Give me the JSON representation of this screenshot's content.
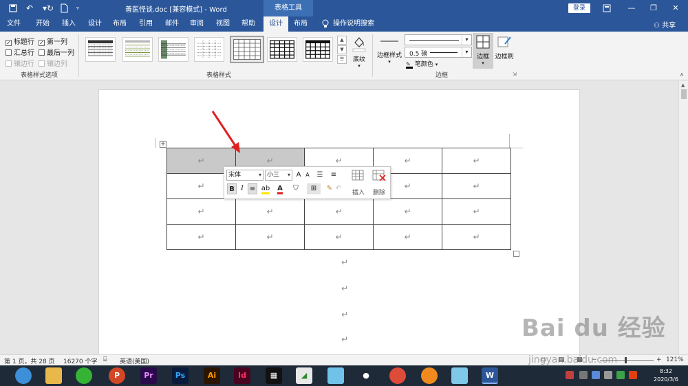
{
  "titlebar": {
    "doc_title": "善医怪谈.doc [兼容模式] - Word",
    "context_title": "表格工具",
    "login": "登录",
    "colors": {
      "bar": "#2b579a"
    }
  },
  "tabs": [
    {
      "label": "文件"
    },
    {
      "label": "开始"
    },
    {
      "label": "插入"
    },
    {
      "label": "设计"
    },
    {
      "label": "布局"
    },
    {
      "label": "引用"
    },
    {
      "label": "邮件"
    },
    {
      "label": "审阅"
    },
    {
      "label": "视图"
    },
    {
      "label": "帮助"
    },
    {
      "label": "设计",
      "active": true
    },
    {
      "label": "布局"
    }
  ],
  "search": {
    "label": "操作说明搜索"
  },
  "share": "共享",
  "ribbon": {
    "options": [
      {
        "label": "标题行",
        "checked": true
      },
      {
        "label": "第一列",
        "checked": true
      },
      {
        "label": "汇总行",
        "checked": false
      },
      {
        "label": "最后一列",
        "checked": false
      },
      {
        "label": "镶边行",
        "checked": false,
        "disabled": true
      },
      {
        "label": "镶边列",
        "checked": false,
        "disabled": true
      }
    ],
    "options_group": "表格样式选项",
    "styles_group": "表格样式",
    "shading": "底纹",
    "border_styles": "边框样式",
    "line_weight": "0.5 磅",
    "pen_color": "笔颜色",
    "borders": "边框",
    "border_painter": "边框刷",
    "borders_group": "边框"
  },
  "table": {
    "rows": [
      [
        "↵",
        "↵",
        "↵",
        "↵",
        "↵"
      ],
      [
        "↵",
        "↵",
        "↵",
        "↵",
        "↵"
      ],
      [
        "↵",
        "↵",
        "↵",
        "↵",
        "↵"
      ],
      [
        "↵",
        "↵",
        "↵",
        "↵",
        "↵"
      ]
    ],
    "selected_cells": [
      [
        0,
        0
      ],
      [
        0,
        1
      ]
    ],
    "paragraph_marks": [
      "↵",
      "↵",
      "↵",
      "↵"
    ],
    "move_handle": "+"
  },
  "minitoolbar": {
    "font": "宋体",
    "size": "小三",
    "grow": "A",
    "shrink": "A",
    "bold": "B",
    "italic": "I",
    "font_color": "A",
    "insert": "插入",
    "delete": "删除"
  },
  "statusbar": {
    "page": "第 1 页，共 28 页",
    "words": "16270 个字",
    "language": "英语(美国)",
    "zoom": "121%"
  },
  "taskbar": {
    "apps": [
      "Pr",
      "Ps",
      "Ai",
      "Id"
    ],
    "time": "8:32",
    "date": "2020/3/6"
  },
  "watermark": {
    "brand": "Bai du 经验",
    "url": "jingyan.baidu.com"
  }
}
